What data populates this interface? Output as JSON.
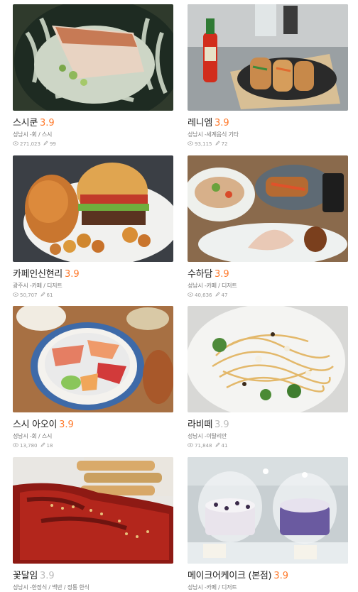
{
  "restaurants": [
    {
      "name": "스시쿤",
      "rating": "3.9",
      "rating_style": "hi",
      "region": "성남시",
      "category": "회 / 스시",
      "views": "271,023",
      "reviews": "99",
      "icon": "grilled-fish-photo"
    },
    {
      "name": "레니엠",
      "rating": "3.9",
      "rating_style": "hi",
      "region": "성남시",
      "category": "세계음식 기타",
      "views": "93,115",
      "reviews": "72",
      "icon": "banh-mi-photo"
    },
    {
      "name": "카페인신현리",
      "rating": "3.9",
      "rating_style": "hi",
      "region": "광주시",
      "category": "카페 / 디저트",
      "views": "50,707",
      "reviews": "61",
      "icon": "burger-photo"
    },
    {
      "name": "수하담",
      "rating": "3.9",
      "rating_style": "hi",
      "region": "성남시",
      "category": "카페 / 디저트",
      "views": "40,636",
      "reviews": "47",
      "icon": "brunch-photo"
    },
    {
      "name": "스시 아오이",
      "rating": "3.9",
      "rating_style": "hi",
      "region": "성남시",
      "category": "회 / 스시",
      "views": "13,780",
      "reviews": "18",
      "icon": "chirashi-photo"
    },
    {
      "name": "라비떼",
      "rating": "3.9",
      "rating_style": "lo",
      "region": "성남시",
      "category": "이탈리안",
      "views": "71,848",
      "reviews": "41",
      "icon": "pasta-photo"
    },
    {
      "name": "꽃달임",
      "rating": "3.9",
      "rating_style": "lo",
      "region": "성남시",
      "category": "한정식 / 백반 / 정통 한식",
      "views": "",
      "reviews": "",
      "icon": "spicy-pork-photo"
    },
    {
      "name": "메이크어케이크 (본점)",
      "rating": "3.9",
      "rating_style": "hi",
      "region": "성남시",
      "category": "카페 / 디저트",
      "views": "",
      "reviews": "",
      "icon": "cake-photo"
    }
  ],
  "region_separator": " -",
  "colors": {
    "rating_high": "#ff792a",
    "rating_low": "#bbbbbb"
  }
}
